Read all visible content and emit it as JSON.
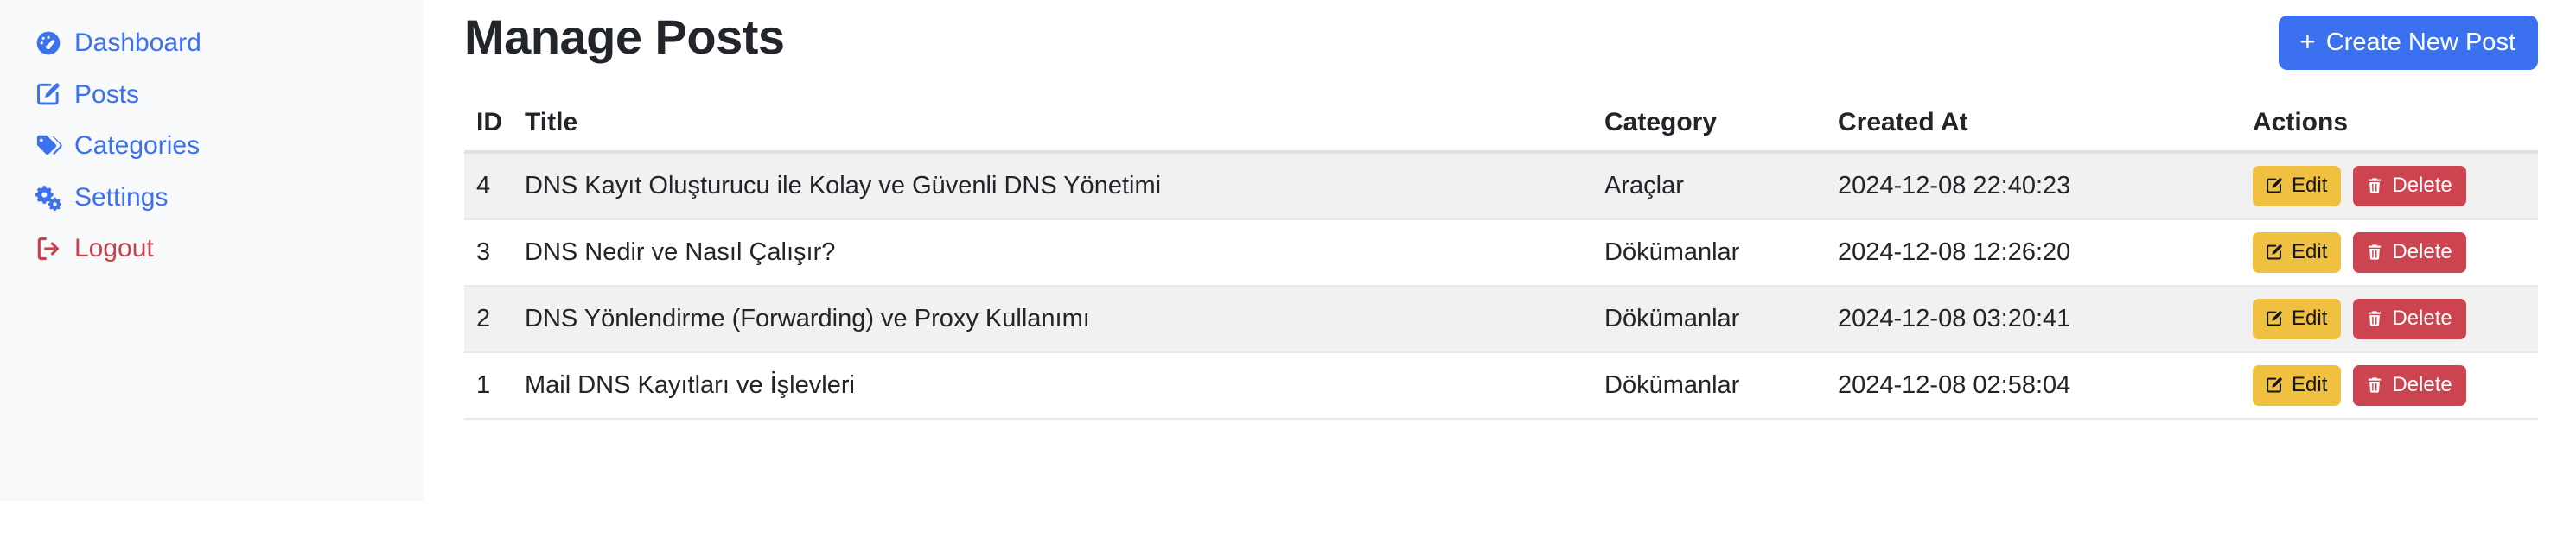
{
  "sidebar": {
    "items": [
      {
        "label": "Dashboard",
        "icon": "dashboard-icon",
        "color": "#3b71f0"
      },
      {
        "label": "Posts",
        "icon": "pen-square-icon",
        "color": "#3b71f0"
      },
      {
        "label": "Categories",
        "icon": "tags-icon",
        "color": "#3b71f0"
      },
      {
        "label": "Settings",
        "icon": "cogs-icon",
        "color": "#3b71f0"
      },
      {
        "label": "Logout",
        "icon": "sign-out-icon",
        "color": "#c9414f"
      }
    ]
  },
  "header": {
    "title": "Manage Posts",
    "create_button": {
      "label": "Create New Post",
      "icon": "plus-icon",
      "color": "#3b71f0"
    }
  },
  "table": {
    "columns": [
      "ID",
      "Title",
      "Category",
      "Created At",
      "Actions"
    ],
    "rows": [
      {
        "id": "4",
        "title": "DNS Kayıt Oluşturucu ile Kolay ve Güvenli DNS Yönetimi",
        "category": "Araçlar",
        "created_at": "2024-12-08 22:40:23",
        "edit": "Edit",
        "delete": "Delete"
      },
      {
        "id": "3",
        "title": "DNS Nedir ve Nasıl Çalışır?",
        "category": "Dökümanlar",
        "created_at": "2024-12-08 12:26:20",
        "edit": "Edit",
        "delete": "Delete"
      },
      {
        "id": "2",
        "title": "DNS Yönlendirme (Forwarding) ve Proxy Kullanımı",
        "category": "Dökümanlar",
        "created_at": "2024-12-08 03:20:41",
        "edit": "Edit",
        "delete": "Delete"
      },
      {
        "id": "1",
        "title": "Mail DNS Kayıtları ve İşlevleri",
        "category": "Dökümanlar",
        "created_at": "2024-12-08 02:58:04",
        "edit": "Edit",
        "delete": "Delete"
      }
    ]
  },
  "colors": {
    "accent": "#3b71f0",
    "danger": "#c9414f",
    "edit_button": "#f0c040",
    "delete_button": "#cc4450",
    "sidebar_bg": "#f8f9fa",
    "row_stripe": "#f1f1f1"
  }
}
